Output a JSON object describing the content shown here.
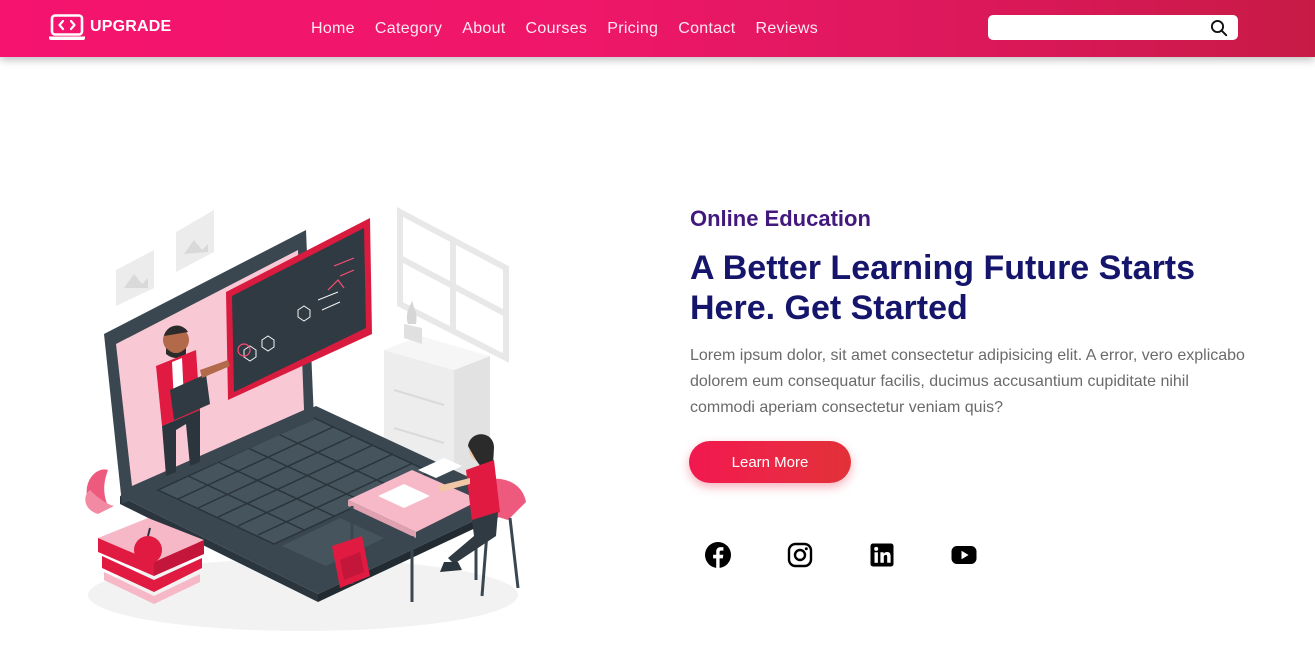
{
  "nav": {
    "brand": "UPGRADE",
    "brand_icon": "laptop-code-icon",
    "links": [
      "Home",
      "Category",
      "About",
      "Courses",
      "Pricing",
      "Contact",
      "Reviews"
    ],
    "search": {
      "placeholder": "",
      "value": "",
      "icon": "search-icon"
    }
  },
  "hero": {
    "subtitle": "Online Education",
    "title": "A Better Learning Future Starts Here. Get Started",
    "description": "Lorem ipsum dolor, sit amet consectetur adipisicing elit. A error, vero explicabo dolorem eum consequatur facilis, ducimus accusantium cupiditate nihil commodi aperiam consectetur veniam quis?",
    "cta": "Learn More",
    "illustration": "online-teaching-laptop-illustration",
    "socials": [
      "facebook-icon",
      "instagram-icon",
      "linkedin-icon",
      "youtube-icon"
    ]
  },
  "colors": {
    "nav_start": "#f5136f",
    "nav_end": "#c71b45",
    "subtitle": "#421a7e",
    "title": "#14156b",
    "text": "#6a6a6a",
    "button": "#ea2944"
  }
}
